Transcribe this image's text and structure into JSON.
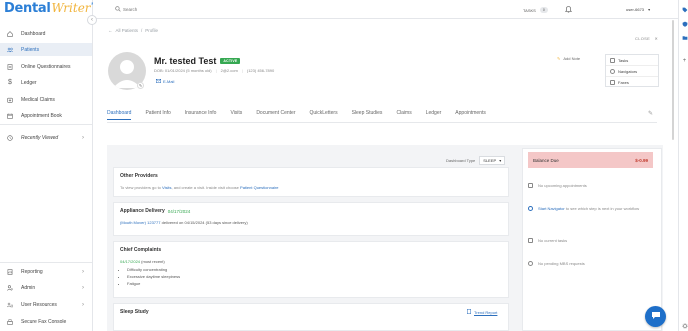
{
  "app": {
    "logo_main": "Dental",
    "logo_script": "Writer",
    "logo_plus": "PLUS"
  },
  "sidebar": {
    "items": [
      {
        "label": "Dashboard",
        "icon": "home-icon"
      },
      {
        "label": "Patients",
        "icon": "patients-icon"
      },
      {
        "label": "Online Questionnaires",
        "icon": "questionnaire-icon"
      },
      {
        "label": "Ledger",
        "icon": "dollar-icon"
      },
      {
        "label": "Medical Claims",
        "icon": "claims-icon"
      },
      {
        "label": "Appointment Book",
        "icon": "calendar-icon"
      },
      {
        "label": "Recently Viewed",
        "icon": "clock-icon"
      }
    ],
    "bottom_items": [
      {
        "label": "Reporting",
        "icon": "report-icon"
      },
      {
        "label": "Admin",
        "icon": "admin-icon"
      },
      {
        "label": "User Resources",
        "icon": "resources-icon"
      },
      {
        "label": "Secure Fax Console",
        "icon": "fax-icon"
      }
    ]
  },
  "topbar": {
    "search_placeholder": "Search",
    "tasks_label": "TASKS",
    "tasks_count": "0",
    "user": "user-6673"
  },
  "breadcrumb": {
    "parent": "All Patients",
    "separator": "/",
    "current": "Profile"
  },
  "close_label": "CLOSE",
  "patient": {
    "name": "Mr. tested Test",
    "status": "ACTIVE",
    "dob": "DOB: 01/01/2024 (5 months old)",
    "email": "2@2.com",
    "phone": "(123) 456-7890",
    "email_action": "E-Mail"
  },
  "add_note": "Add Note",
  "side_menu": [
    "Tasks",
    "Navigators",
    "Faxes"
  ],
  "tabs": [
    "Dashboard",
    "Patient Info",
    "Insurance Info",
    "Visits",
    "Document Center",
    "QuickLetters",
    "Sleep Studies",
    "Claims",
    "Ledger",
    "Appointments"
  ],
  "dashboard": {
    "type_label": "Dashboard Type",
    "type_value": "SLEEP",
    "other_providers": {
      "title": "Other Providers",
      "text_before": "To view providers go to",
      "link_visits": "Visits",
      "text_mid": ", and create a visit. Inside visit choose",
      "link_q": "Patient Questionnaire"
    },
    "appliance": {
      "title": "Appliance Delivery",
      "date": "04/17/2024",
      "item": "(Mouth Mover) 123777",
      "delivered": "delivered on",
      "delivered_date": "04/15/2024 (53 days since delivery)"
    },
    "complaints": {
      "title": "Chief Complaints",
      "date": "04/17/2024",
      "note": "(most recent)",
      "items": [
        "Difficulty concentrating",
        "Excessive daytime sleepiness",
        "Fatigue"
      ]
    },
    "sleep_study": {
      "title": "Sleep Study",
      "trend": "Trend Report"
    }
  },
  "right_panel": {
    "balance_label": "Balance Due",
    "balance_value": "$-0.99",
    "appointments": "No upcoming appointments",
    "navigator_link": "Start Navigator",
    "navigator_text": "to see which step is next in your workflow",
    "tasks": "No current tasks",
    "mbs": "No pending MBS requests"
  },
  "colors": {
    "primary": "#2c6fbd",
    "active_badge": "#36a852",
    "balance_bg": "#f4c7c7",
    "chat": "#1e6fc9"
  }
}
